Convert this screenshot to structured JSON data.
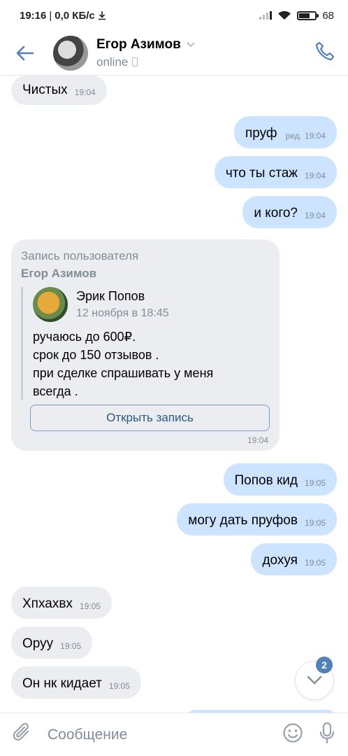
{
  "statusbar": {
    "time": "19:16",
    "net_speed": "0,0 КБ/с",
    "battery": "68",
    "battery_level": 0.68
  },
  "header": {
    "name": "Егор Азимов",
    "status": "online"
  },
  "messages": [
    {
      "dir": "in",
      "text": "Чистых",
      "time": "19:04"
    },
    {
      "dir": "out",
      "text": "пруф",
      "edited": "ред.",
      "time": "19:04"
    },
    {
      "dir": "out",
      "text": "что ты стаж",
      "time": "19:04"
    },
    {
      "dir": "out",
      "text": "и кого?",
      "time": "19:04"
    },
    {
      "dir": "out",
      "text": "Попов кид",
      "time": "19:05"
    },
    {
      "dir": "out",
      "text": "могу дать пруфов",
      "time": "19:05"
    },
    {
      "dir": "out",
      "text": "дохуя",
      "time": "19:05"
    },
    {
      "dir": "in",
      "text": "Хпхахвх",
      "time": "19:05"
    },
    {
      "dir": "in",
      "text": "Оруу",
      "time": "19:05"
    },
    {
      "dir": "in",
      "text": "Он нк кидает",
      "time": "19:05"
    }
  ],
  "repost": {
    "caption": "Запись пользователя",
    "owner": "Егор Азимов",
    "author": "Эрик Попов",
    "date": "12 ноября в 18:45",
    "text_lines": [
      "ручаюсь до 600₽.",
      "срок до 150 отзывов .",
      "при сделке спрашивать у меня",
      "всегда ."
    ],
    "open_label": "Открыть запись",
    "time": "19:04"
  },
  "scroll": {
    "unread": "2"
  },
  "composer": {
    "placeholder": "Сообщение"
  },
  "colors": {
    "accent": "#5181b8",
    "in_bubble": "#ebedf0",
    "out_bubble": "#cce4ff"
  }
}
